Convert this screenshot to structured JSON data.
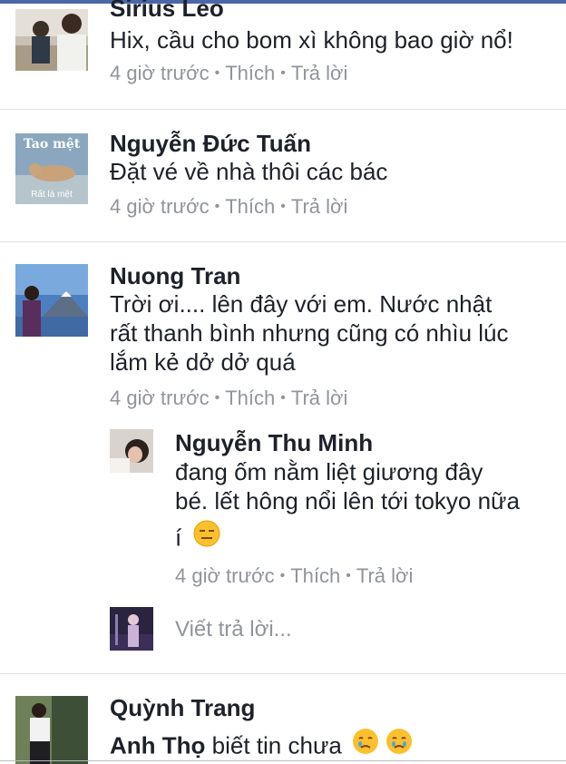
{
  "comments": [
    {
      "name": "Sirius Leo",
      "text": "Hix, cầu cho bom xì không bao giờ nổ!",
      "time": "4 giờ trước",
      "like": "Thích",
      "reply": "Trả lời"
    },
    {
      "name": "Nguyễn Đức Tuấn",
      "avatar_text_top": "Tao mệt",
      "avatar_text_bottom": "Rất là mệt",
      "text": "Đặt vé về nhà thôi các bác",
      "time": "4 giờ trước",
      "like": "Thích",
      "reply": "Trả lời"
    },
    {
      "name": "Nuong Tran",
      "text_lines": [
        "Trời ơi.... lên đây với em. Nước nhật",
        "rất thanh bình nhưng cũng có nhìu lúc",
        "lắm kẻ dở dở quá"
      ],
      "time": "4 giờ trước",
      "like": "Thích",
      "reply": "Trả lời"
    },
    {
      "name": "Nguyễn Thu Minh",
      "text_lines": [
        "đang ốm nằm liệt giương đây",
        "bé. lết hông nổi lên tới tokyo nữa",
        "í"
      ],
      "emoji": "expressionless-face",
      "time": "4 giờ trước",
      "like": "Thích",
      "reply": "Trả lời"
    },
    {
      "name": "Quỳnh Trang",
      "mention": "Anh Thọ",
      "text": "biết tin chưa",
      "emoji": "crying-face"
    }
  ],
  "write_reply_placeholder": "Viết trả lời..."
}
